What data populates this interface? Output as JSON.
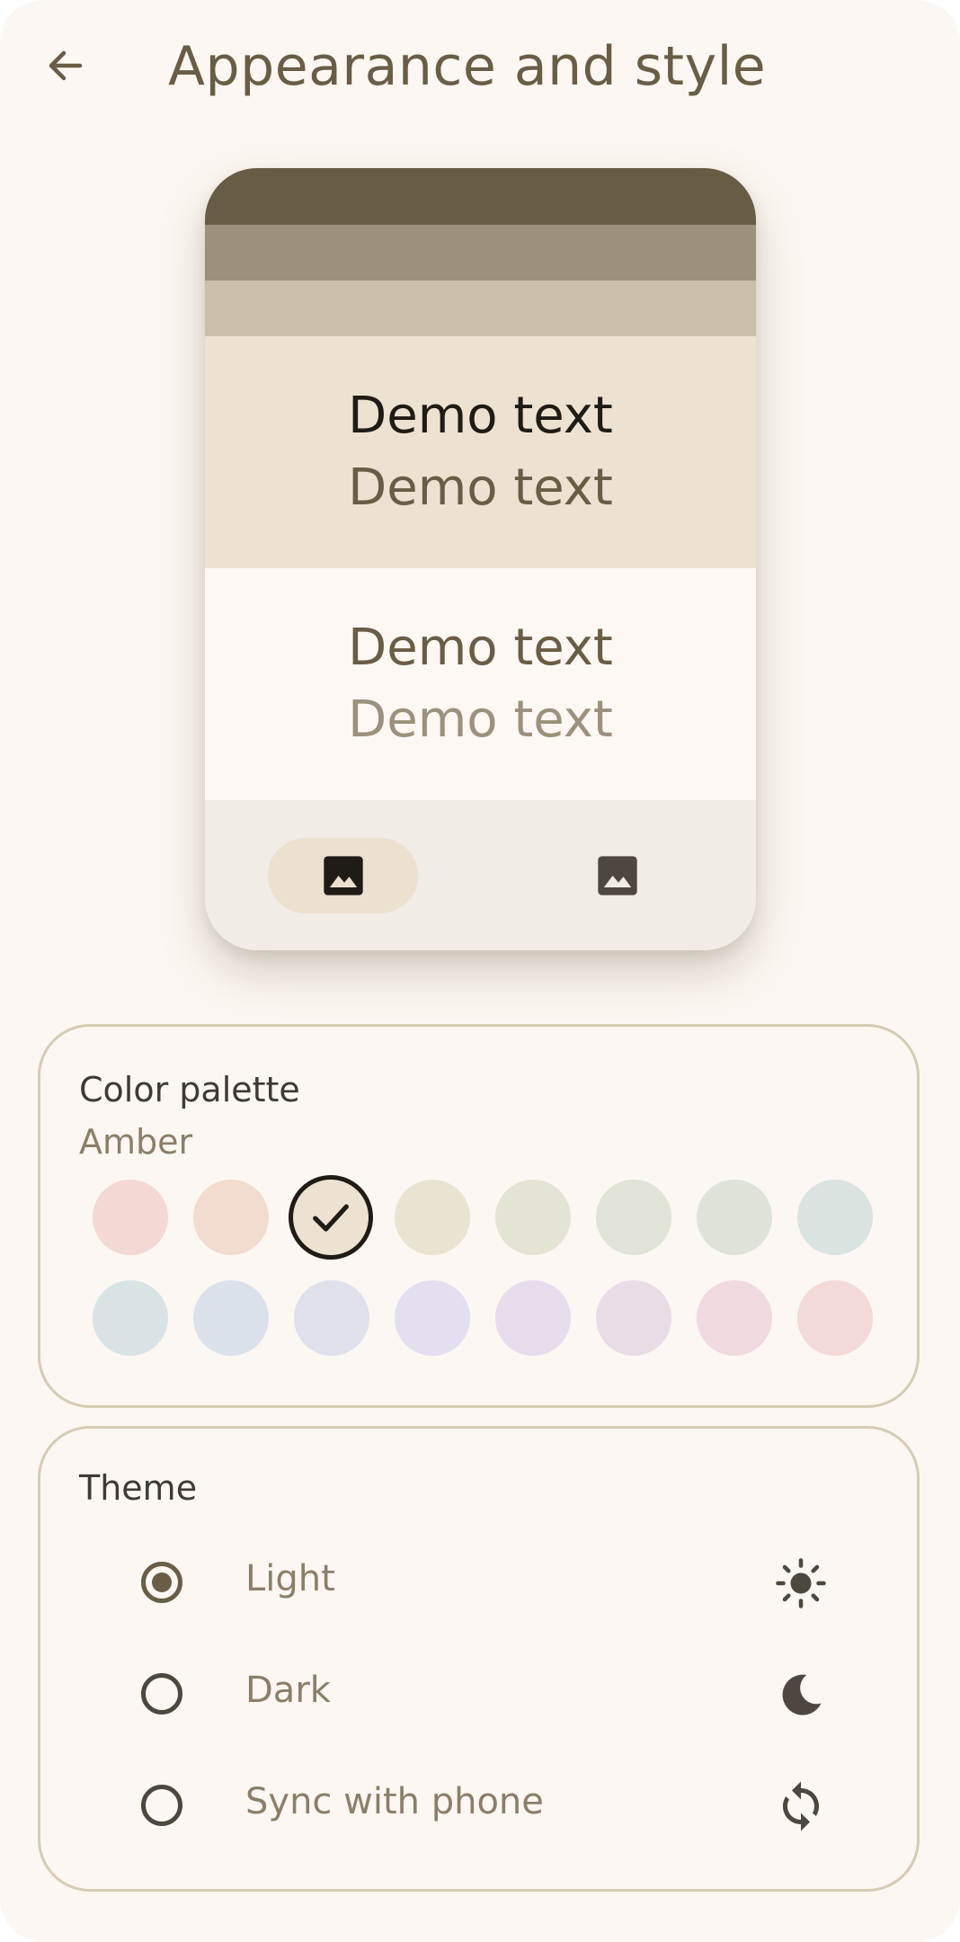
{
  "header": {
    "title": "Appearance and style",
    "back_icon": "arrow-left-icon"
  },
  "preview": {
    "demo_texts": [
      "Demo text",
      "Demo text",
      "Demo text",
      "Demo text"
    ],
    "nav_icons": [
      "image-icon",
      "image-icon"
    ],
    "colors": {
      "band1": "#675c44",
      "band2": "#9c917c",
      "band3": "#cbbfab",
      "primary_container": "#ede2d1",
      "surface": "#fdf8f4",
      "nav": "#f2ece6"
    }
  },
  "palette": {
    "title": "Color palette",
    "selected_name": "Amber",
    "swatches_row1": [
      "#f3d8d3",
      "#f2dccf",
      "#ede2d1",
      "#e9e3d1",
      "#e5e4d4",
      "#e0e3d6",
      "#dee3da",
      "#d9e3e0"
    ],
    "swatches_row2": [
      "#d8e3e6",
      "#dbe1eb",
      "#dee0ec",
      "#e3def0",
      "#e6dcec",
      "#eadce6",
      "#f1dadf",
      "#f3d9d7"
    ],
    "selected_index": 2
  },
  "theme": {
    "title": "Theme",
    "options": [
      {
        "label": "Light",
        "icon": "sun-icon",
        "selected": true
      },
      {
        "label": "Dark",
        "icon": "moon-icon",
        "selected": false
      },
      {
        "label": "Sync with phone",
        "icon": "sync-icon",
        "selected": false
      }
    ]
  }
}
